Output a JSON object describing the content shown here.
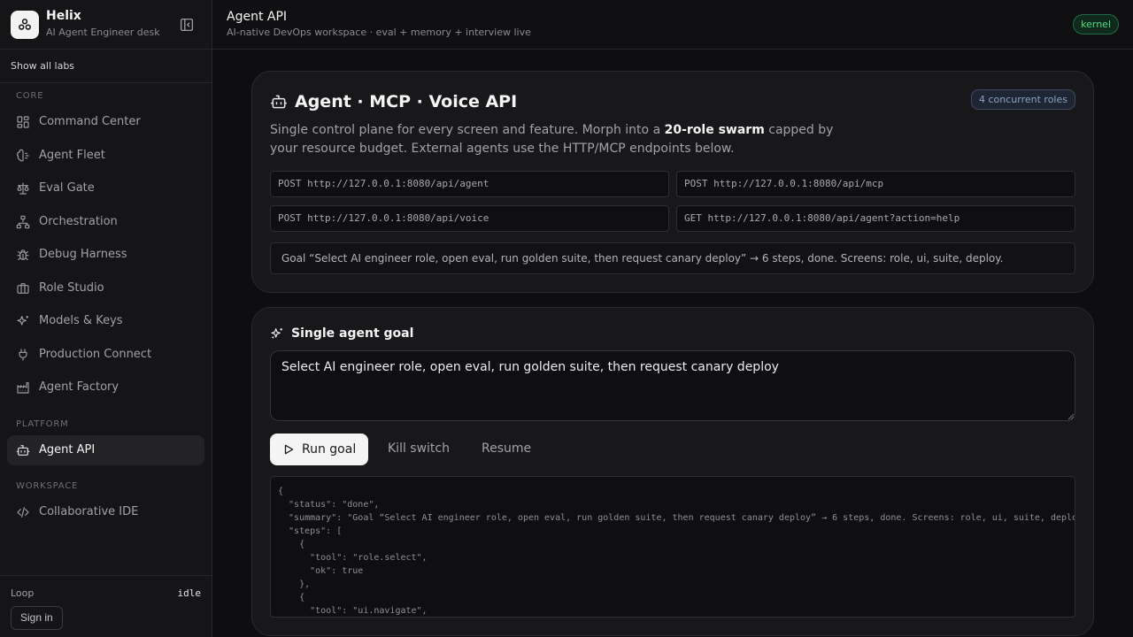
{
  "brand": {
    "name": "Helix",
    "subtitle": "AI Agent Engineer desk"
  },
  "sidebar": {
    "show_all": "Show all labs",
    "sections": {
      "core": "CORE",
      "platform": "PLATFORM",
      "workspace": "WORKSPACE"
    },
    "items": [
      {
        "label": "Command Center",
        "icon": "layout-dashboard-icon"
      },
      {
        "label": "Agent Fleet",
        "icon": "brain-icon"
      },
      {
        "label": "Eval Gate",
        "icon": "scale-icon"
      },
      {
        "label": "Orchestration",
        "icon": "network-icon"
      },
      {
        "label": "Debug Harness",
        "icon": "bug-icon"
      },
      {
        "label": "Role Studio",
        "icon": "briefcase-icon"
      },
      {
        "label": "Models & Keys",
        "icon": "sparkles-icon"
      },
      {
        "label": "Production Connect",
        "icon": "plug-icon"
      },
      {
        "label": "Agent Factory",
        "icon": "factory-icon"
      },
      {
        "label": "Agent API",
        "icon": "bot-icon",
        "active": true
      },
      {
        "label": "Collaborative IDE",
        "icon": "code-icon"
      }
    ],
    "footer": {
      "loop_label": "Loop",
      "loop_value": "idle",
      "sign_in": "Sign in"
    }
  },
  "topbar": {
    "title": "Agent API",
    "subtitle": "AI-native DevOps workspace · eval + memory + interview live",
    "badge": "kernel"
  },
  "api_card": {
    "title": "Agent · MCP · Voice API",
    "badge": "4 concurrent roles",
    "desc_before": "Single control plane for every screen and feature. Morph into a ",
    "desc_bold": "20-role swarm",
    "desc_after": " capped by your resource budget. External agents use the HTTP/MCP endpoints below.",
    "endpoints": [
      "POST http://127.0.0.1:8080/api/agent",
      "POST http://127.0.0.1:8080/api/mcp",
      "POST http://127.0.0.1:8080/api/voice",
      "GET http://127.0.0.1:8080/api/agent?action=help"
    ],
    "goal_summary": "Goal “Select AI engineer role, open eval, run golden suite, then request canary deploy” → 6 steps, done. Screens: role, ui, suite, deploy."
  },
  "goal_card": {
    "title": "Single agent goal",
    "input_value": "Select AI engineer role, open eval, run golden suite, then request canary deploy",
    "run_label": "Run goal",
    "kill_label": "Kill switch",
    "resume_label": "Resume",
    "output_lines": [
      "{",
      "  \"status\": \"done\",",
      "  \"summary\": \"Goal “Select AI engineer role, open eval, run golden suite, then request canary deploy” → 6 steps, done. Screens: role, ui, suite, deploy.\",",
      "  \"steps\": [",
      "    {",
      "      \"tool\": \"role.select\",",
      "      \"ok\": true",
      "    },",
      "    {",
      "      \"tool\": \"ui.navigate\","
    ]
  },
  "colors": {
    "background": "#0e0e10",
    "sidebar": "#151517",
    "card": "#18181b",
    "kernel_badge": "#4ade80",
    "roles_badge": "#8ea2c4",
    "primary_button": "#f4f4f5"
  }
}
